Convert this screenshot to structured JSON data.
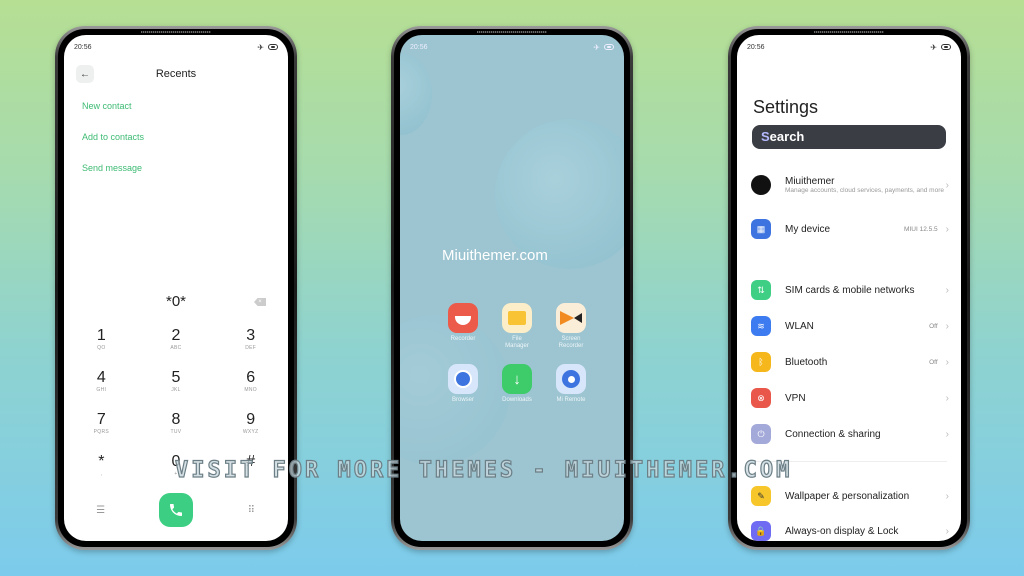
{
  "status_time": "20:56",
  "dialer": {
    "title": "Recents",
    "links": [
      "New contact",
      "Add to contacts",
      "Send message"
    ],
    "number": "*0*",
    "keys": [
      {
        "digit": "1",
        "letters": "QO"
      },
      {
        "digit": "2",
        "letters": "ABC"
      },
      {
        "digit": "3",
        "letters": "DEF"
      },
      {
        "digit": "4",
        "letters": "GHI"
      },
      {
        "digit": "5",
        "letters": "JKL"
      },
      {
        "digit": "6",
        "letters": "MNO"
      },
      {
        "digit": "7",
        "letters": "PQRS"
      },
      {
        "digit": "8",
        "letters": "TUV"
      },
      {
        "digit": "9",
        "letters": "WXYZ"
      },
      {
        "digit": "*",
        "letters": ","
      },
      {
        "digit": "0",
        "letters": "+"
      },
      {
        "digit": "#",
        "letters": ""
      }
    ],
    "call_color": "#3ccf83",
    "link_color": "#3dbb73"
  },
  "home": {
    "brand": "Miuithemer.com",
    "apps": [
      {
        "label": "Recorder",
        "icon": "recorder-icon",
        "color": "#ec5a4a"
      },
      {
        "label": "File\nManager",
        "icon": "folder-icon",
        "color": "#fbeec8"
      },
      {
        "label": "Screen\nRecorder",
        "icon": "screen-recorder-icon",
        "color": "#fbeed8"
      },
      {
        "label": "Browser",
        "icon": "browser-icon",
        "color": "#d7e6fb"
      },
      {
        "label": "Downloads",
        "icon": "download-icon",
        "color": "#3ecb6a"
      },
      {
        "label": "Mi Remote",
        "icon": "remote-icon",
        "color": "#d7e6fb"
      }
    ]
  },
  "settings": {
    "title": "Settings",
    "search_label": "Search",
    "account": {
      "name": "Miuithemer",
      "sub": "Manage accounts, cloud services, payments, and more"
    },
    "device": {
      "label": "My device",
      "value": "MIUI 12.5.5"
    },
    "items": [
      {
        "label": "SIM cards & mobile networks",
        "value": "",
        "icon": "sim-icon",
        "color": "#3ecf85"
      },
      {
        "label": "WLAN",
        "value": "Off",
        "icon": "wifi-icon",
        "color": "#3d7cf0"
      },
      {
        "label": "Bluetooth",
        "value": "Off",
        "icon": "bluetooth-icon",
        "color": "#f5b71c"
      },
      {
        "label": "VPN",
        "value": "",
        "icon": "vpn-icon",
        "color": "#e8574a"
      },
      {
        "label": "Connection & sharing",
        "value": "",
        "icon": "connection-icon",
        "color": "#a3a9d9"
      },
      {
        "label": "Wallpaper & personalization",
        "value": "",
        "icon": "wallpaper-icon",
        "color": "#f6c62b"
      },
      {
        "label": "Always-on display & Lock",
        "value": "",
        "icon": "lock-icon",
        "color": "#6f6bf2"
      }
    ]
  },
  "watermark": "VISIT FOR MORE THEMES - MIUITHEMER.COM"
}
